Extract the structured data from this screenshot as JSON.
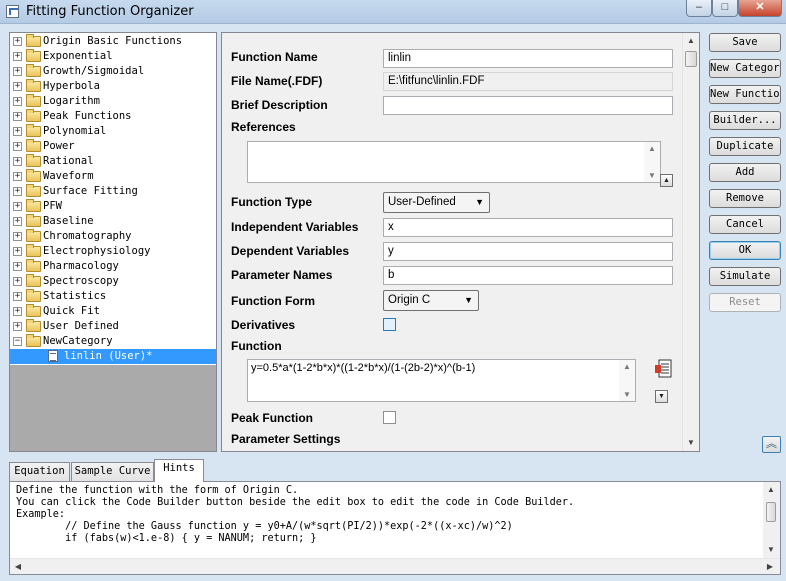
{
  "window": {
    "title": "Fitting Function Organizer",
    "controls": {
      "minimize": "–",
      "maximize": "□",
      "close": "✕"
    }
  },
  "tree": {
    "categories": [
      "Origin Basic Functions",
      "Exponential",
      "Growth/Sigmoidal",
      "Hyperbola",
      "Logarithm",
      "Peak Functions",
      "Polynomial",
      "Power",
      "Rational",
      "Waveform",
      "Surface Fitting",
      "PFW",
      "Baseline",
      "Chromatography",
      "Electrophysiology",
      "Pharmacology",
      "Spectroscopy",
      "Statistics",
      "Quick Fit",
      "User Defined",
      "NewCategory"
    ],
    "selected_item": "linlin (User)*"
  },
  "form": {
    "function_name_label": "Function Name",
    "function_name_value": "linlin",
    "file_name_label": "File Name(.FDF)",
    "file_name_value": "E:\\fitfunc\\linlin.FDF",
    "brief_description_label": "Brief Description",
    "brief_description_value": "",
    "references_label": "References",
    "references_value": "",
    "function_type_label": "Function Type",
    "function_type_value": "User-Defined",
    "independent_vars_label": "Independent Variables",
    "independent_vars_value": "x",
    "dependent_vars_label": "Dependent Variables",
    "dependent_vars_value": "y",
    "parameter_names_label": "Parameter Names",
    "parameter_names_value": "b",
    "function_form_label": "Function Form",
    "function_form_value": "Origin C",
    "derivatives_label": "Derivatives",
    "function_label": "Function",
    "function_value": "y=0.5*a*(1-2*b*x)*((1-2*b*x)/(1-(2b-2)*x)^(b-1)",
    "peak_function_label": "Peak Function",
    "parameter_settings_label": "Parameter Settings"
  },
  "buttons": {
    "save": "Save",
    "new_category": "New Category",
    "new_function": "New Function",
    "builder": "Builder...",
    "duplicate": "Duplicate",
    "add": "Add",
    "remove": "Remove",
    "cancel": "Cancel",
    "ok": "OK",
    "simulate": "Simulate",
    "reset": "Reset"
  },
  "tabs": [
    "Equation",
    "Sample Curve",
    "Hints"
  ],
  "active_tab": "Hints",
  "hints": [
    "Define the function with the form of Origin C.",
    "You can click the Code Builder button beside the edit box to edit the code in Code Builder.",
    "Example:",
    "        // Define the Gauss function y = y0+A/(w*sqrt(PI/2))*exp(-2*((x-xc)/w)^2)",
    "        if (fabs(w)<1.e-8) { y = NANUM; return; }"
  ],
  "colors": {
    "selection": "#3399ff",
    "dialog_bg": "#f0f0f0",
    "tree_empty": "#aaaaaa"
  }
}
